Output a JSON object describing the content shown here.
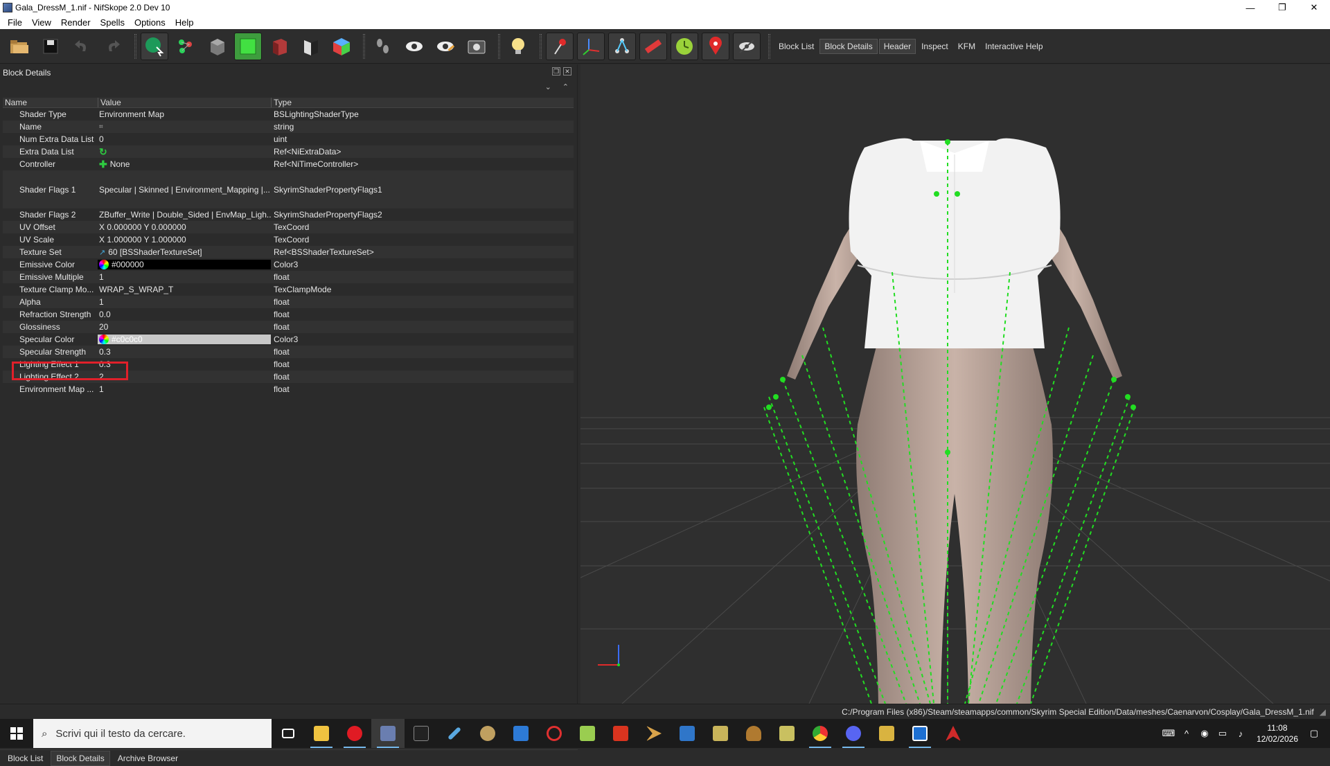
{
  "window": {
    "title": "Gala_DressM_1.nif - NifSkope 2.0 Dev 10",
    "controls": {
      "minimize": "—",
      "restore": "❐",
      "close": "✕"
    }
  },
  "menu": [
    "File",
    "View",
    "Render",
    "Spells",
    "Options",
    "Help"
  ],
  "toolbar": {
    "tabs": [
      "Block List",
      "Block Details",
      "Header",
      "Inspect",
      "KFM",
      "Interactive Help"
    ],
    "active_tab_index": 1
  },
  "panel": {
    "title": "Block Details",
    "columns": {
      "name": "Name",
      "value": "Value",
      "type": "Type"
    },
    "rows": [
      {
        "name": "Shader Type",
        "value": "Environment Map",
        "type": "BSLightingShaderType",
        "icon": ""
      },
      {
        "name": "Name",
        "value": "",
        "type": "string",
        "icon": "tag-icon"
      },
      {
        "name": "Num Extra Data List",
        "value": "0",
        "type": "uint",
        "icon": ""
      },
      {
        "name": "Extra Data List",
        "value": "",
        "type": "Ref<NiExtraData>",
        "icon": "refresh-icon"
      },
      {
        "name": "Controller",
        "value": "None",
        "type": "Ref<NiTimeController>",
        "icon": "plus-icon"
      },
      {
        "name": "Shader Flags 1",
        "value": "Specular | Skinned | Environment_Mapping |...",
        "type": "SkyrimShaderPropertyFlags1",
        "icon": ""
      },
      {
        "name": "Shader Flags 2",
        "value": "ZBuffer_Write | Double_Sided | EnvMap_Ligh...",
        "type": "SkyrimShaderPropertyFlags2",
        "icon": ""
      },
      {
        "name": "UV Offset",
        "value": "X 0.000000 Y 0.000000",
        "type": "TexCoord",
        "icon": ""
      },
      {
        "name": "UV Scale",
        "value": "X 1.000000 Y 1.000000",
        "type": "TexCoord",
        "icon": ""
      },
      {
        "name": "Texture Set",
        "value": "60 [BSShaderTextureSet]",
        "type": "Ref<BSShaderTextureSet>",
        "icon": "link-icon"
      },
      {
        "name": "Emissive Color",
        "value": "#000000",
        "type": "Color3",
        "icon": "color-wheel-icon"
      },
      {
        "name": "Emissive Multiple",
        "value": "1",
        "type": "float",
        "icon": ""
      },
      {
        "name": "Texture Clamp Mo...",
        "value": "WRAP_S_WRAP_T",
        "type": "TexClampMode",
        "icon": ""
      },
      {
        "name": "Alpha",
        "value": "1",
        "type": "float",
        "icon": ""
      },
      {
        "name": "Refraction Strength",
        "value": "0.0",
        "type": "float",
        "icon": ""
      },
      {
        "name": "Glossiness",
        "value": "20",
        "type": "float",
        "icon": ""
      },
      {
        "name": "Specular Color",
        "value": "#c0c0c0",
        "type": "Color3",
        "icon": "color-wheel-icon"
      },
      {
        "name": "Specular Strength",
        "value": "0.3",
        "type": "float",
        "icon": ""
      },
      {
        "name": "Lighting Effect 1",
        "value": "0.3",
        "type": "float",
        "icon": ""
      },
      {
        "name": "Lighting Effect 2",
        "value": "2",
        "type": "float",
        "icon": ""
      },
      {
        "name": "Environment Map ...",
        "value": "1",
        "type": "float",
        "icon": ""
      }
    ],
    "bottom_tabs": [
      "Block List",
      "Block Details",
      "Archive Browser"
    ],
    "active_bottom_tab_index": 1
  },
  "statusbar": {
    "path": "C:/Program Files (x86)/Steam/steamapps/common/Skyrim Special Edition/Data/meshes/Caenarvon/Cosplay/Gala_DressM_1.nif"
  },
  "taskbar": {
    "search_placeholder": "Scrivi qui il testo da cercare.",
    "time": "11:08",
    "date": "12/02/2026"
  },
  "colors": {
    "emissive": "#000000",
    "specular": "#c0c0c0",
    "highlight": "#e0202a",
    "skeleton": "#22dd22"
  }
}
